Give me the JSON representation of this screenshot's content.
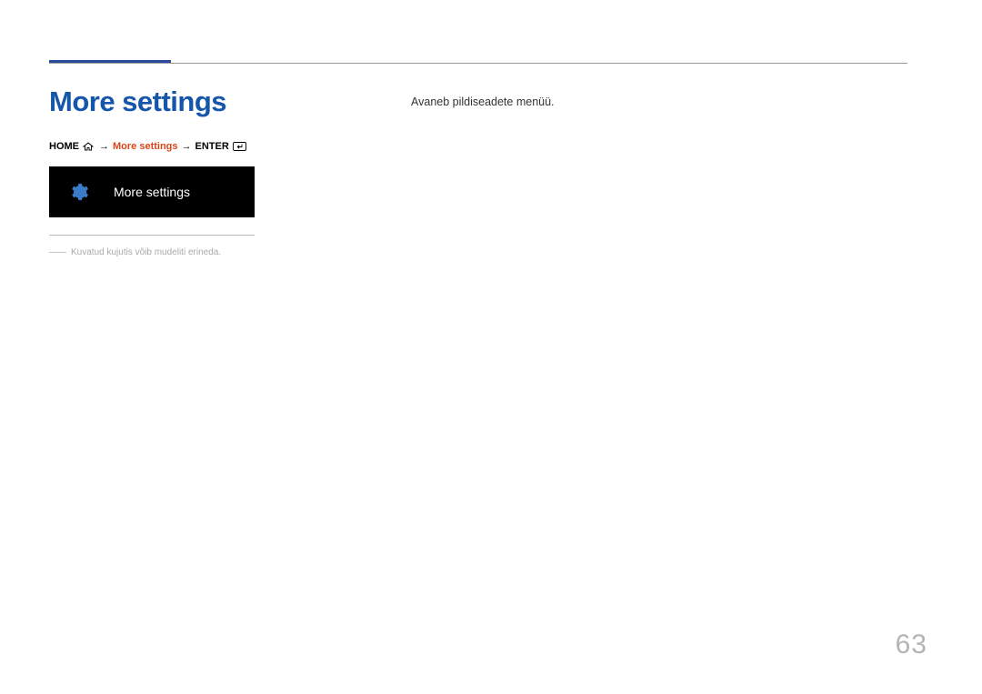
{
  "title": "More settings",
  "breadcrumb": {
    "home": "HOME",
    "arrow1": "→",
    "middle": "More settings",
    "arrow2": "→",
    "enter": "ENTER"
  },
  "tile": {
    "label": "More settings"
  },
  "footnote": {
    "dash": "――",
    "text": "Kuvatud kujutis võib mudeliti erineda."
  },
  "body": {
    "text": "Avaneb pildiseadete menüü."
  },
  "page_number": "63"
}
